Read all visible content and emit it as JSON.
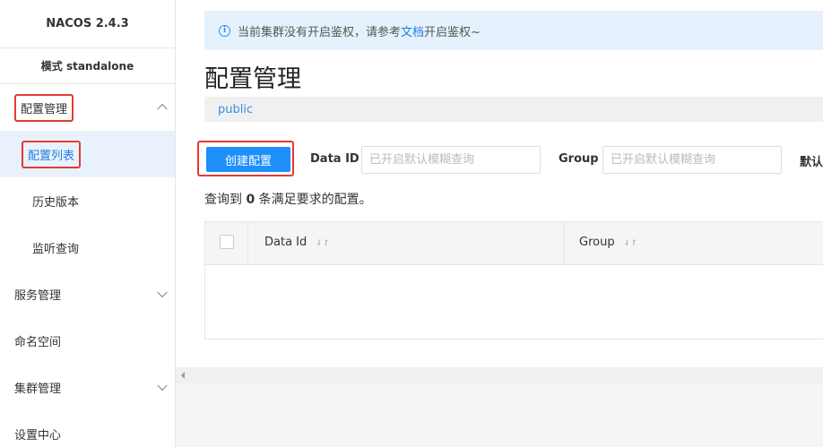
{
  "sidebar": {
    "brand": "NACOS 2.4.3",
    "mode": "模式 standalone",
    "config_group": "配置管理",
    "config_list": "配置列表",
    "history": "历史版本",
    "listener": "监听查询",
    "service_group": "服务管理",
    "namespace": "命名空间",
    "cluster_group": "集群管理",
    "settings": "设置中心"
  },
  "notice": {
    "icon": "info-icon",
    "text_before": "当前集群没有开启鉴权，请参考",
    "link": "文档",
    "text_after": "开启鉴权~"
  },
  "main": {
    "title": "配置管理",
    "namespace": "public",
    "create_button": "创建配置",
    "data_id_label": "Data ID",
    "data_id_placeholder": "已开启默认模糊查询",
    "group_label": "Group",
    "group_placeholder": "已开启默认模糊查询",
    "extra_label": "默认",
    "result_prefix": "查询到 ",
    "result_count": "0",
    "result_suffix": " 条满足要求的配置。"
  },
  "table": {
    "columns": [
      "Data Id",
      "Group"
    ]
  },
  "colors": {
    "accent": "#1f8ffc",
    "highlight": "#e53935"
  }
}
